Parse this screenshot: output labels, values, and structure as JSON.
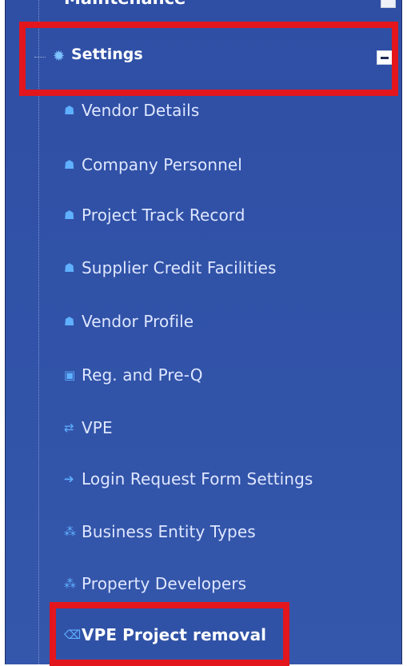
{
  "menu": {
    "top_item": {
      "label": "Maintenance",
      "toggle_icon": "collapse-toggle"
    },
    "settings": {
      "label": "Settings",
      "icon": "gear-icon",
      "toggle_icon": "collapse-minus-icon"
    },
    "items": [
      {
        "label": "Vendor Details",
        "icon": "user-icon"
      },
      {
        "label": "Company Personnel",
        "icon": "user-icon"
      },
      {
        "label": "Project Track Record",
        "icon": "user-icon"
      },
      {
        "label": "Supplier Credit Facilities",
        "icon": "user-icon"
      },
      {
        "label": "Vendor Profile",
        "icon": "user-icon"
      },
      {
        "label": "Reg. and Pre-Q",
        "icon": "id-card-icon"
      },
      {
        "label": "VPE",
        "icon": "exchange-icon"
      },
      {
        "label": "Login Request Form Settings",
        "icon": "sign-in-icon"
      },
      {
        "label": "Business Entity Types",
        "icon": "users-icon"
      },
      {
        "label": "Property Developers",
        "icon": "users-icon"
      },
      {
        "label": "VPE Project removal",
        "icon": "backspace-icon"
      }
    ]
  },
  "colors": {
    "panel_bg": "#3153a8",
    "highlight_border": "#e2161c",
    "icon_color": "#5fb0ff",
    "text_color": "#dfe7ff"
  }
}
